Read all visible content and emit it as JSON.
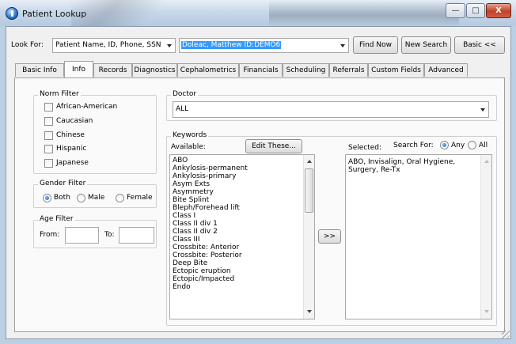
{
  "window": {
    "title": "Patient Lookup",
    "minimize": "—",
    "maximize": "□",
    "close": "X"
  },
  "search": {
    "look_for_label": "Look For:",
    "look_for_value": "Patient Name, ID, Phone, SSN",
    "query_value": "Doleac, Matthew ID:DEMO6",
    "find_now": "Find Now",
    "new_search": "New Search",
    "basic": "Basic <<"
  },
  "tabs": [
    {
      "label": "Basic Info"
    },
    {
      "label": "Info"
    },
    {
      "label": "Records"
    },
    {
      "label": "Diagnostics"
    },
    {
      "label": "Cephalometrics"
    },
    {
      "label": "Financials"
    },
    {
      "label": "Scheduling"
    },
    {
      "label": "Referrals"
    },
    {
      "label": "Custom Fields"
    },
    {
      "label": "Advanced"
    }
  ],
  "active_tab": "Info",
  "norm_filter": {
    "title": "Norm Filter",
    "options": [
      {
        "label": "African-American",
        "checked": false
      },
      {
        "label": "Caucasian",
        "checked": false
      },
      {
        "label": "Chinese",
        "checked": false
      },
      {
        "label": "Hispanic",
        "checked": false
      },
      {
        "label": "Japanese",
        "checked": false
      }
    ]
  },
  "gender_filter": {
    "title": "Gender Filter",
    "options": [
      "Both",
      "Male",
      "Female"
    ],
    "selected": "Both"
  },
  "age_filter": {
    "title": "Age Filter",
    "from_label": "From:",
    "to_label": "To:",
    "from_value": "",
    "to_value": ""
  },
  "doctor": {
    "title": "Doctor",
    "value": "ALL"
  },
  "keywords": {
    "title": "Keywords",
    "available_label": "Available:",
    "edit_button": "Edit These...",
    "selected_label": "Selected:",
    "search_for_label": "Search For:",
    "search_for_options": [
      "Any",
      "All"
    ],
    "search_for_selected": "Any",
    "move_button": ">>",
    "available": [
      "ABO",
      "Ankylosis-permanent",
      "Ankylosis-primary",
      "Asym Exts",
      "Asymmetry",
      "Bite Splint",
      "Bleph/Forehead lift",
      "Class I",
      "Class II div 1",
      "Class II div 2",
      "Class III",
      "Crossbite: Anterior",
      "Crossbite: Posterior",
      "Deep Bite",
      "Ectopic eruption",
      "Ectopic/Impacted",
      "Endo"
    ],
    "selected_text_line1": "ABO, Invisalign, Oral Hygiene,",
    "selected_text_line2": "Surgery, Re-Tx"
  }
}
